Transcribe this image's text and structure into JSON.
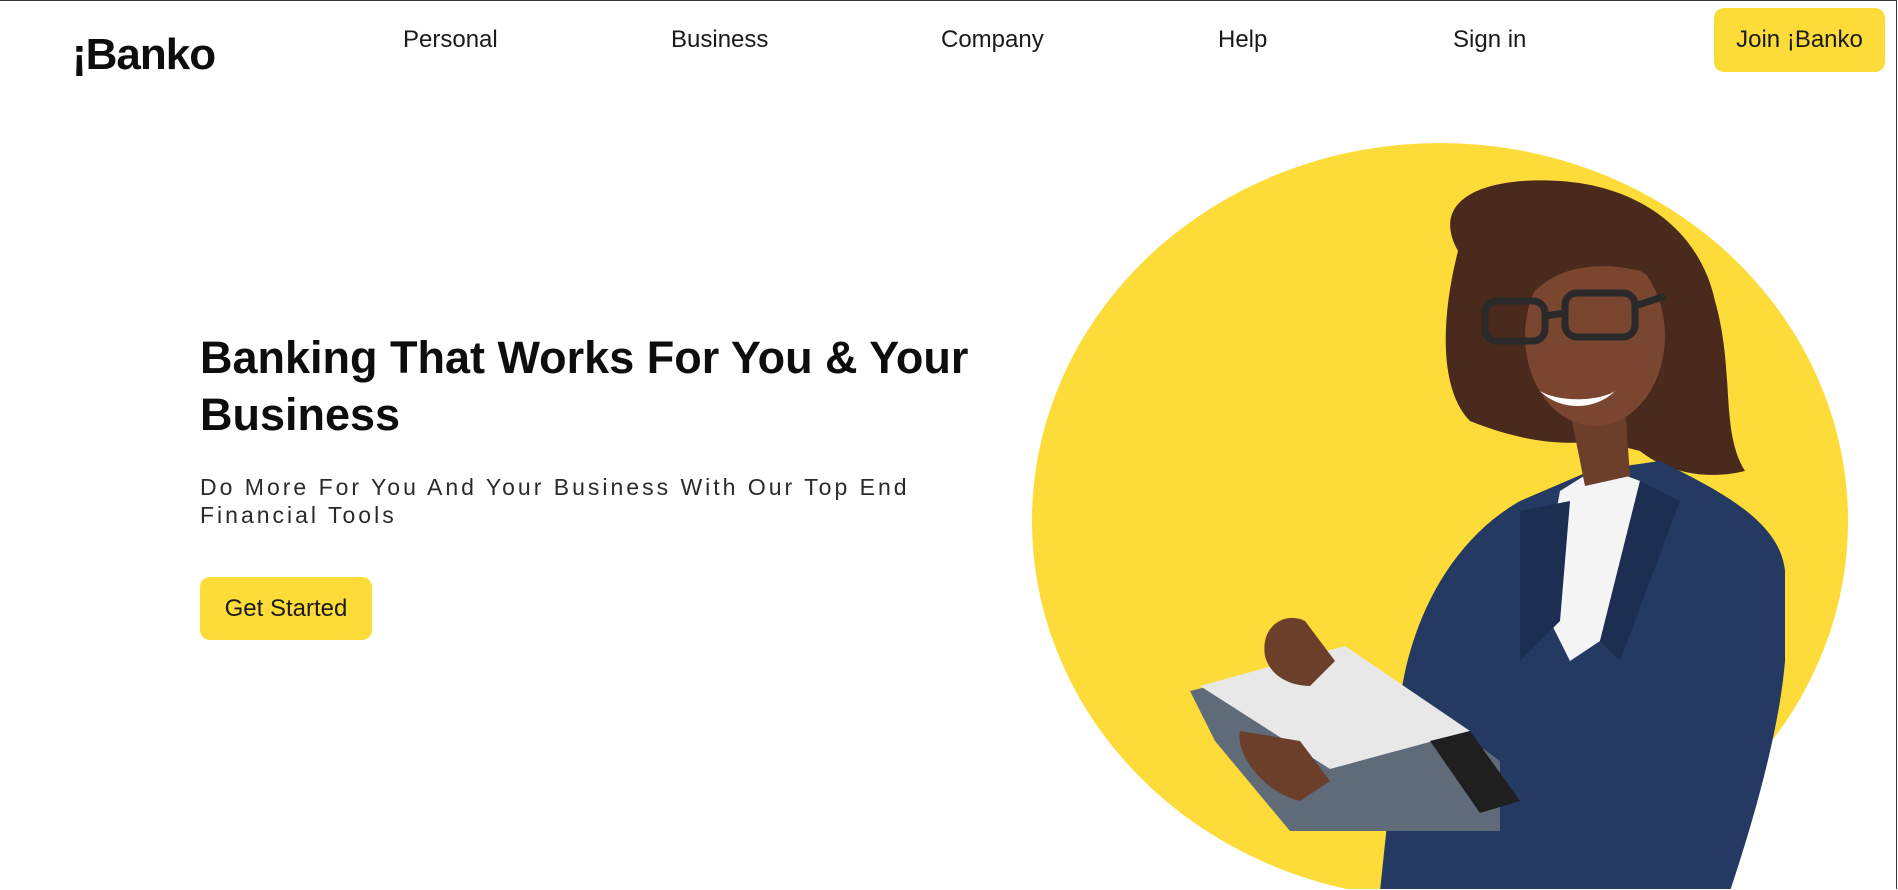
{
  "brand": {
    "logo_text": "¡Banko",
    "accent_color": "#fddc3a"
  },
  "nav": {
    "items": [
      {
        "label": "Personal"
      },
      {
        "label": "Business"
      },
      {
        "label": "Company"
      },
      {
        "label": "Help"
      },
      {
        "label": "Sign in"
      }
    ],
    "cta_label": "Join ¡Banko"
  },
  "hero": {
    "title": "Banking That Works For You & Your Business",
    "subtitle": "Do More For You And Your Business With Our Top End Financial Tools",
    "cta_label": "Get Started",
    "image": {
      "icon": "businesswoman-holding-folder-photo",
      "background_circle_color": "#fddc3a"
    }
  }
}
